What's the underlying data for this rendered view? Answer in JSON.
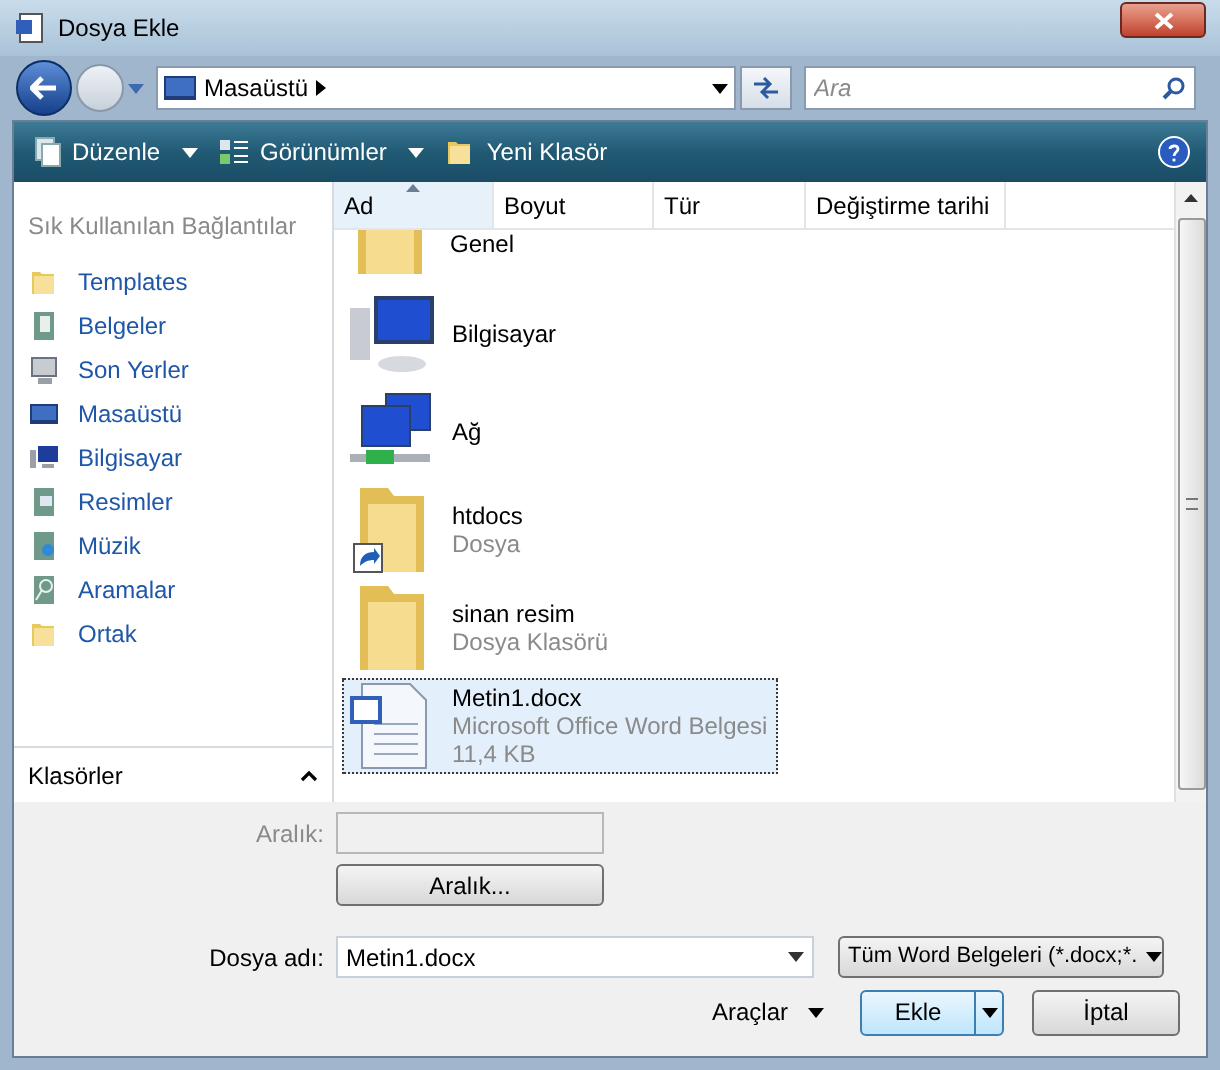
{
  "window": {
    "title": "Dosya Ekle"
  },
  "address": {
    "location": "Masaüstü"
  },
  "search": {
    "placeholder": "Ara"
  },
  "toolbar": [
    {
      "label": "Düzenle",
      "kind": "menu"
    },
    {
      "label": "Görünümler",
      "kind": "menu"
    },
    {
      "label": "Yeni Klasör",
      "kind": "button"
    }
  ],
  "sidebar": {
    "heading": "Sık Kullanılan Bağlantılar",
    "footer": "Klasörler",
    "items": [
      {
        "label": "Templates",
        "kind": "folder"
      },
      {
        "label": "Belgeler",
        "kind": "documents"
      },
      {
        "label": "Son Yerler",
        "kind": "recent"
      },
      {
        "label": "Masaüstü",
        "kind": "desktop"
      },
      {
        "label": "Bilgisayar",
        "kind": "computer"
      },
      {
        "label": "Resimler",
        "kind": "pictures"
      },
      {
        "label": "Müzik",
        "kind": "music"
      },
      {
        "label": "Aramalar",
        "kind": "searches"
      },
      {
        "label": "Ortak",
        "kind": "folder"
      }
    ]
  },
  "columns": [
    {
      "label": "Ad",
      "sorted": true
    },
    {
      "label": "Boyut",
      "sorted": false
    },
    {
      "label": "Tür",
      "sorted": false
    },
    {
      "label": "Değiştirme tarihi",
      "sorted": false
    }
  ],
  "files": [
    {
      "name": "Genel",
      "kind": "folder",
      "selected": false
    },
    {
      "name": "Bilgisayar",
      "kind": "computer",
      "selected": false
    },
    {
      "name": "Ağ",
      "kind": "network",
      "selected": false
    },
    {
      "name": "htdocs",
      "type": "Dosya",
      "kind": "shortcut",
      "selected": false
    },
    {
      "name": "sinan resim",
      "type": "Dosya Klasörü",
      "kind": "folder",
      "selected": false
    },
    {
      "name": "Metin1.docx",
      "type": "Microsoft Office Word Belgesi",
      "size": "11,4 KB",
      "kind": "document",
      "selected": true
    }
  ],
  "range": {
    "label": "Aralık:",
    "disabled": true,
    "button": "Aralık..."
  },
  "filename": {
    "label": "Dosya adı:",
    "value": "Metin1.docx"
  },
  "filter": {
    "value": "Tüm Word Belgeleri (*.docx;*."
  },
  "buttons": {
    "tools": "Araçlar",
    "ok": "Ekle",
    "cancel": "İptal"
  }
}
